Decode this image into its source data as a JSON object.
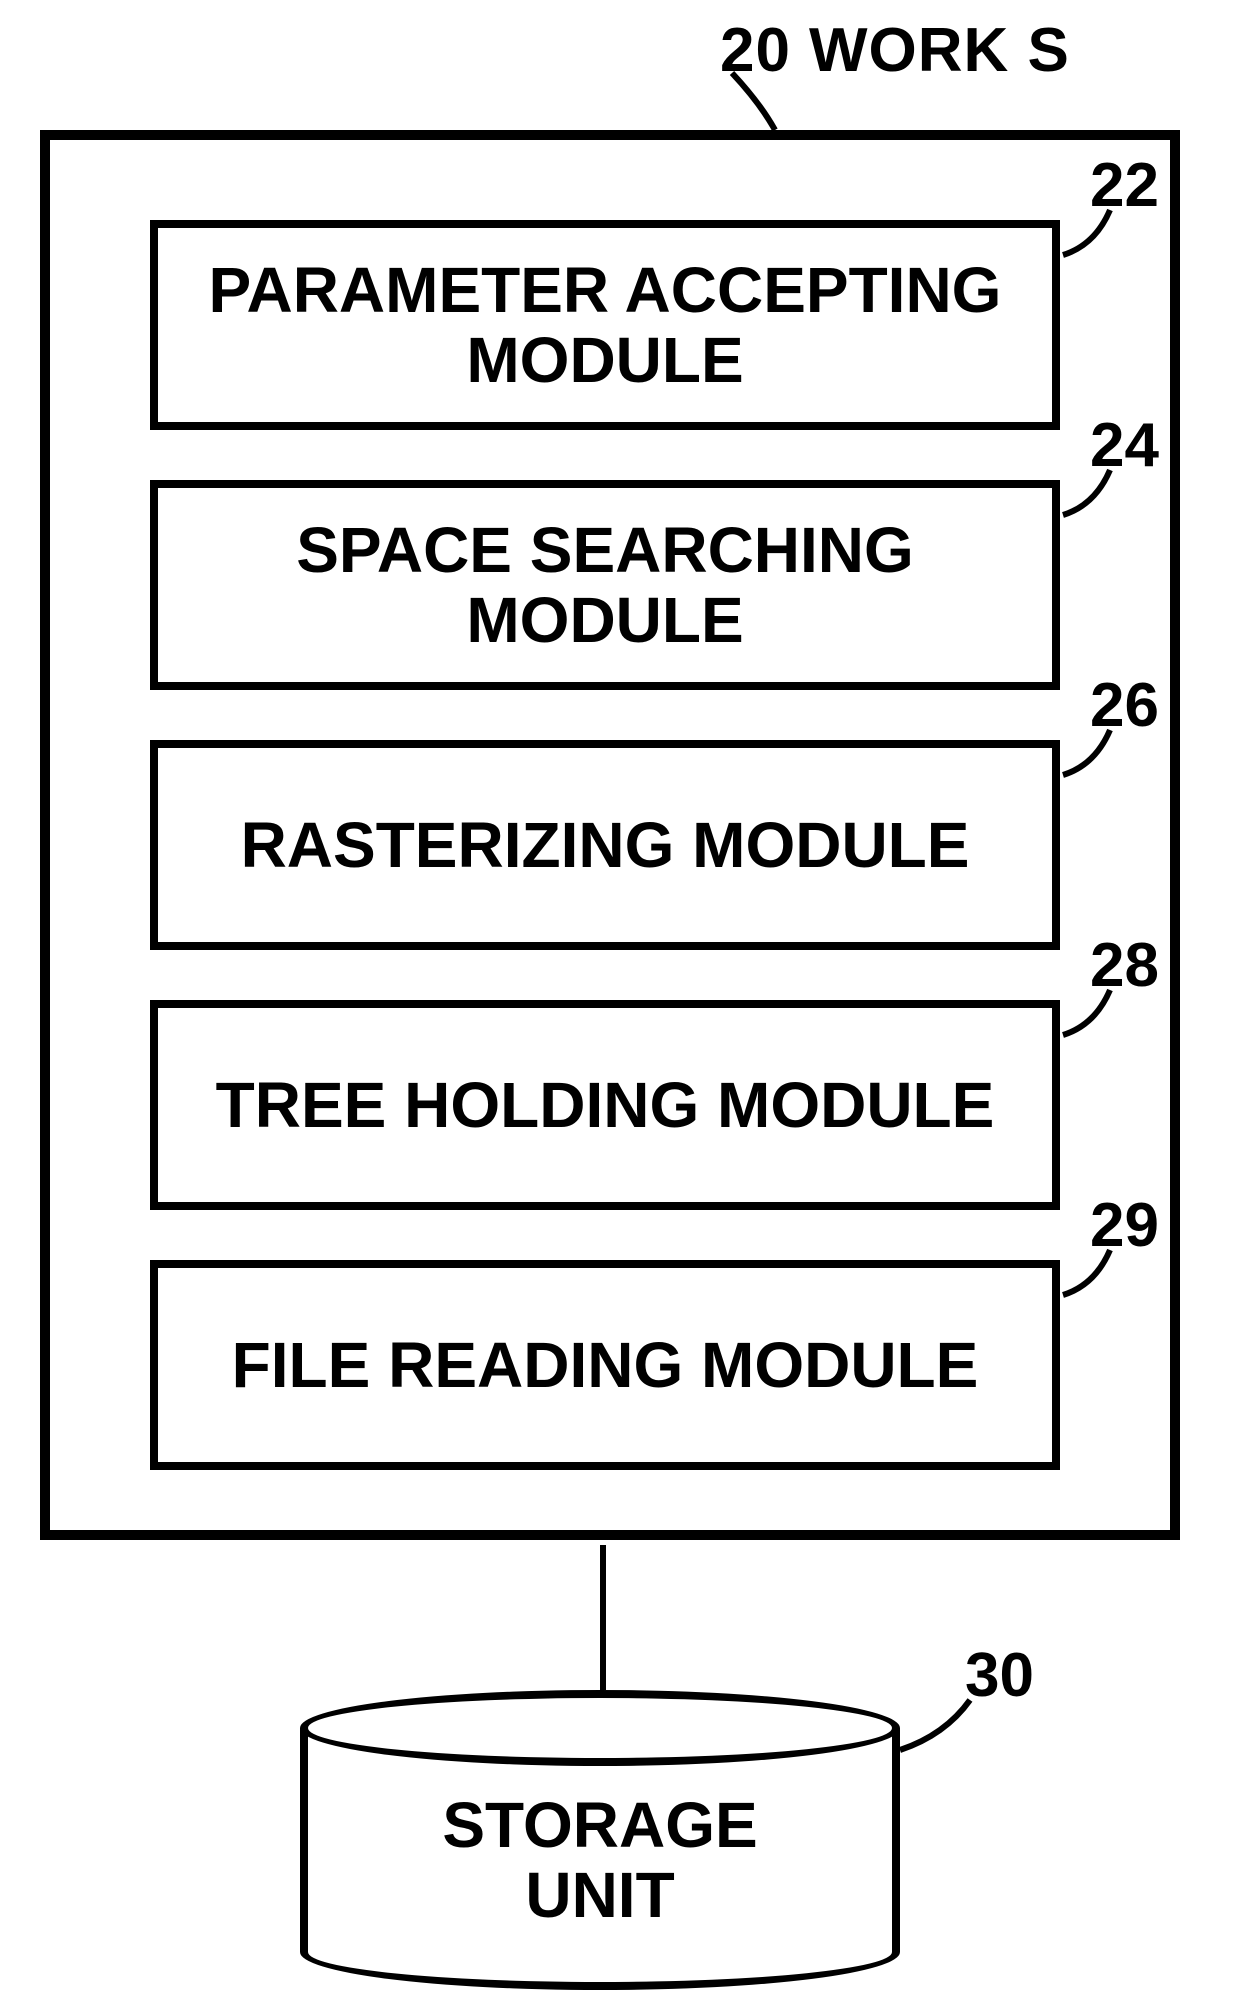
{
  "container": {
    "ref": "20",
    "label": "WORK S"
  },
  "modules": [
    {
      "ref": "22",
      "label": "PARAMETER ACCEPTING MODULE"
    },
    {
      "ref": "24",
      "label": "SPACE SEARCHING MODULE"
    },
    {
      "ref": "26",
      "label": "RASTERIZING MODULE"
    },
    {
      "ref": "28",
      "label": "TREE HOLDING MODULE"
    },
    {
      "ref": "29",
      "label": "FILE READING MODULE"
    }
  ],
  "storage": {
    "ref": "30",
    "label": "STORAGE UNIT"
  }
}
